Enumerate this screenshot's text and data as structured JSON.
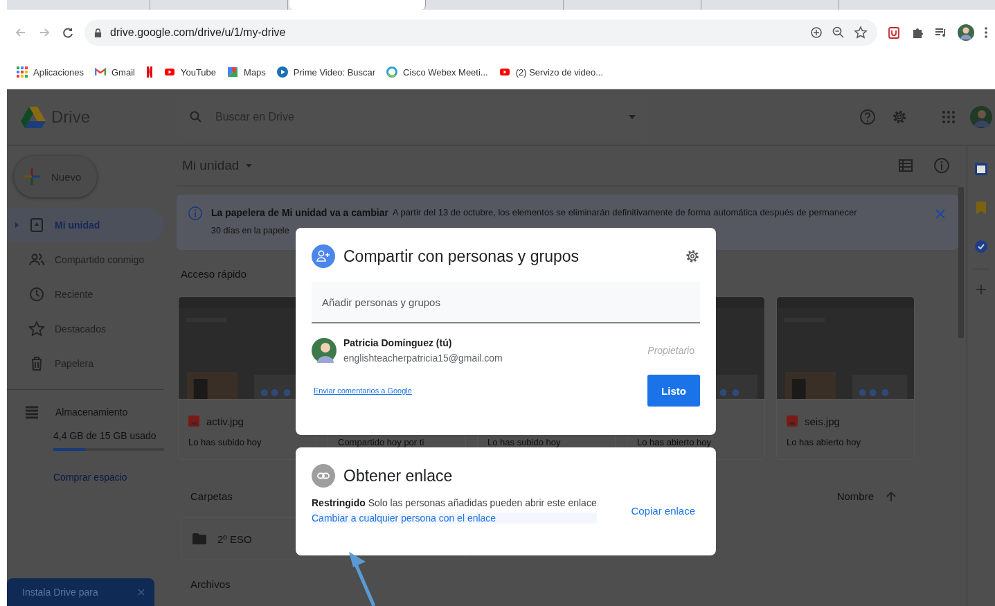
{
  "browser": {
    "tabs": [
      {
        "selected": false
      },
      {
        "selected": false
      },
      {
        "selected": true
      },
      {
        "selected": false
      },
      {
        "selected": false
      },
      {
        "selected": false
      }
    ],
    "url": "drive.google.com/drive/u/1/my-drive",
    "bookmarks": [
      {
        "kind": "apps",
        "label": "Aplicaciones"
      },
      {
        "kind": "gmail",
        "label": "Gmail"
      },
      {
        "kind": "netflix"
      },
      {
        "kind": "youtube",
        "label": "YouTube"
      },
      {
        "kind": "maps",
        "label": "Maps"
      },
      {
        "kind": "prime",
        "label": "Prime Video: Buscar"
      },
      {
        "kind": "webex",
        "label": "Cisco Webex Meeti..."
      },
      {
        "kind": "youtube",
        "label": "(2) Servizo de video..."
      }
    ]
  },
  "drive": {
    "logo": "Drive",
    "search": {
      "placeholder": "Buscar en Drive"
    },
    "new_button": "Nuevo",
    "nav": [
      {
        "kind": "drive",
        "label": "Mi unidad",
        "selected": true
      },
      {
        "kind": "shared",
        "label": "Compartido conmigo",
        "selected": false
      },
      {
        "kind": "recent",
        "label": "Reciente",
        "selected": false
      },
      {
        "kind": "starred",
        "label": "Destacados",
        "selected": false
      },
      {
        "kind": "trash",
        "label": "Papelera",
        "selected": false
      }
    ],
    "storage": {
      "label": "Almacenamiento",
      "usage": "4,4 GB de 15 GB usado",
      "level": 0.29,
      "buy": "Comprar espacio"
    },
    "install_banner": "Instala Drive para",
    "main": {
      "title": "Mi unidad",
      "notice": {
        "title": "La papelera de Mi unidad va a cambiar",
        "line_1": "A partir del 13 de octubre, los elementos se eliminarán definitivamente de forma automática después de permanecer",
        "line_2": "30 días en la papele"
      },
      "quick_access": {
        "heading": "Acceso rápido",
        "cards": [
          {
            "kind": "picture",
            "name": "activ.jpg",
            "caption": "Lo has subido hoy"
          },
          {
            "caption": "Compartido hoy por ti"
          },
          {
            "caption": "Lo has subido hoy"
          },
          {
            "kind": "picture",
            "caption": "Lo has abierto hoy"
          },
          {
            "kind": "picture",
            "name": "seis.jpg",
            "caption": "Lo has abierto hoy"
          }
        ]
      },
      "folders_heading": "Carpetas",
      "sort": "Nombre",
      "folders": [
        {
          "name": "2º ESO"
        }
      ],
      "files_heading": "Archivos"
    }
  },
  "share_dialog": {
    "title": "Compartir con personas y grupos",
    "input": {
      "placeholder": "Añadir personas y grupos"
    },
    "person": {
      "name": "Patricia Domínguez (tú)",
      "email": "englishteacherpatricia15@gmail.com",
      "role": "Propietario"
    },
    "feedback_link": "Enviar comentarios a Google",
    "done_button": "Listo"
  },
  "link_dialog": {
    "title": "Obtener enlace",
    "access": "Restringido",
    "description": "Solo las personas añadidas pueden abrir este enlace",
    "change_link": "Cambiar a cualquier persona con el enlace",
    "copy_button": "Copiar enlace"
  }
}
